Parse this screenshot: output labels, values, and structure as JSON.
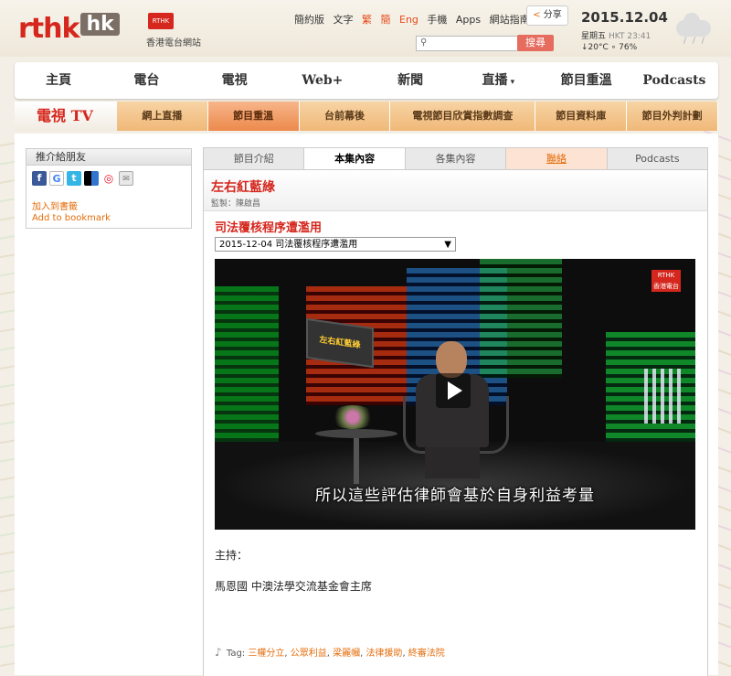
{
  "header": {
    "logo_main": "rthk",
    "logo_hk": "hk",
    "logo_badge": "RTHK",
    "logo_sub": "香港電台網站",
    "toplinks": [
      "簡約版",
      "文字",
      "繁",
      "簡",
      "Eng",
      "手機",
      "Apps",
      "網站指南"
    ],
    "share_label": "分享",
    "search_placeholder": "",
    "search_button": "搜尋",
    "date": "2015.12.04",
    "weekday": "星期五",
    "time": "HKT 23:41",
    "weather": "↓20°C ∘ 76%"
  },
  "main_nav": [
    "主頁",
    "電台",
    "電視",
    "Web+",
    "新聞",
    "直播",
    "節目重溫",
    "Podcasts"
  ],
  "tv_nav": {
    "brand": "電視 TV",
    "items": [
      "網上直播",
      "節目重溫",
      "台前幕後",
      "電視節目欣賞指數調查",
      "節目資料庫",
      "節目外判計劃"
    ],
    "active_index": 1
  },
  "sidebar": {
    "box_title": "推介給朋友",
    "icons": [
      "facebook-icon",
      "google-icon",
      "twitter-icon",
      "delicious-icon",
      "weibo-icon",
      "email-icon"
    ],
    "bookmark_zh": "加入到書籤",
    "bookmark_en": "Add to bookmark"
  },
  "tabs": {
    "items": [
      "節目介紹",
      "本集內容",
      "各集內容",
      "聯絡",
      "Podcasts"
    ],
    "active_index": 1
  },
  "program": {
    "title": "左右紅藍綠",
    "producer": "監製：陳啟昌",
    "episode_title": "司法覆核程序遭濫用",
    "episode_select": "2015-12-04 司法覆核程序遭濫用"
  },
  "video": {
    "screen_text": "左右紅藍綠",
    "logo_top": "RTHK",
    "logo_bottom": "香港電台",
    "subtitle": "所以這些評估律師會基於自身利益考量"
  },
  "details": {
    "host_label": "主持：",
    "guest": "馬恩國  中澳法學交流基金會主席",
    "tag_label": "Tag:",
    "tags": [
      "三權分立",
      "公眾利益",
      "梁麗幗",
      "法律援助",
      "終審法院"
    ]
  }
}
